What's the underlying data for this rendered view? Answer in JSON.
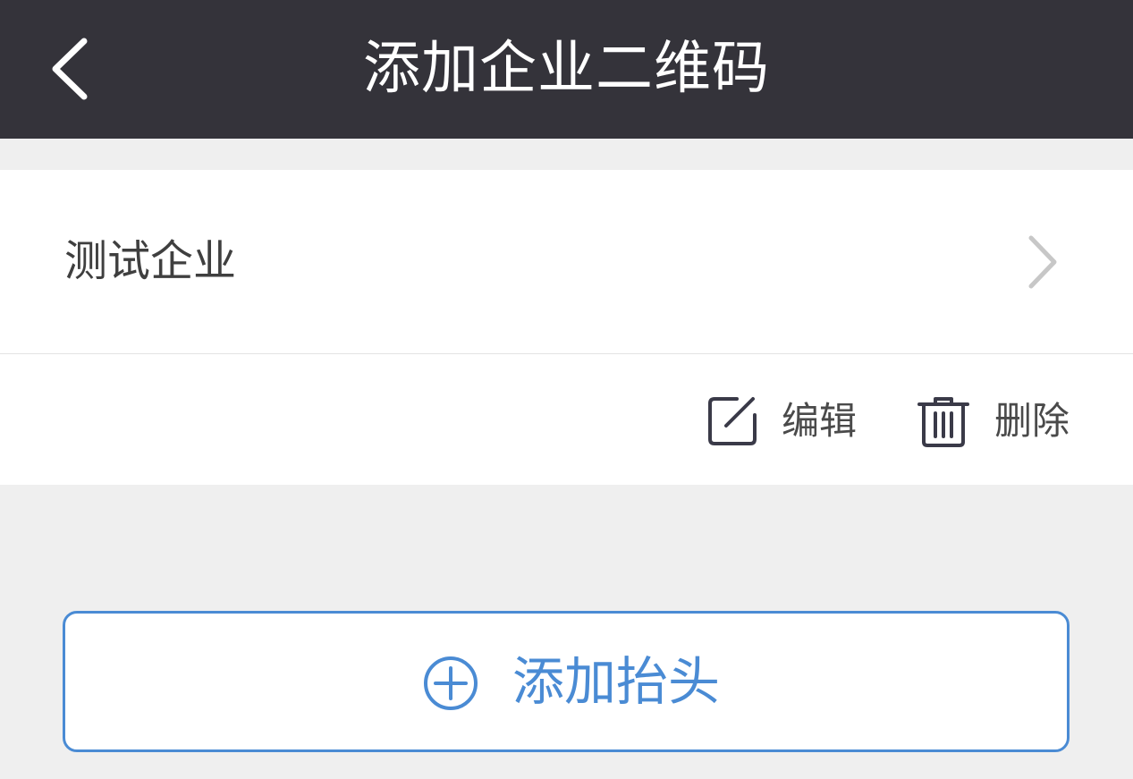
{
  "navbar": {
    "title": "添加企业二维码",
    "back_icon": "chevron-left-icon"
  },
  "company": {
    "name": "测试企业",
    "chevron_icon": "chevron-right-icon"
  },
  "actions": {
    "edit_label": "编辑",
    "edit_icon": "edit-icon",
    "delete_label": "删除",
    "delete_icon": "trash-icon"
  },
  "add_header": {
    "label": "添加抬头",
    "icon": "plus-circle-icon"
  },
  "colors": {
    "navbar_bg": "#34333a",
    "page_bg": "#efefef",
    "accent": "#4a8bd4",
    "text": "#3f3f3f"
  }
}
